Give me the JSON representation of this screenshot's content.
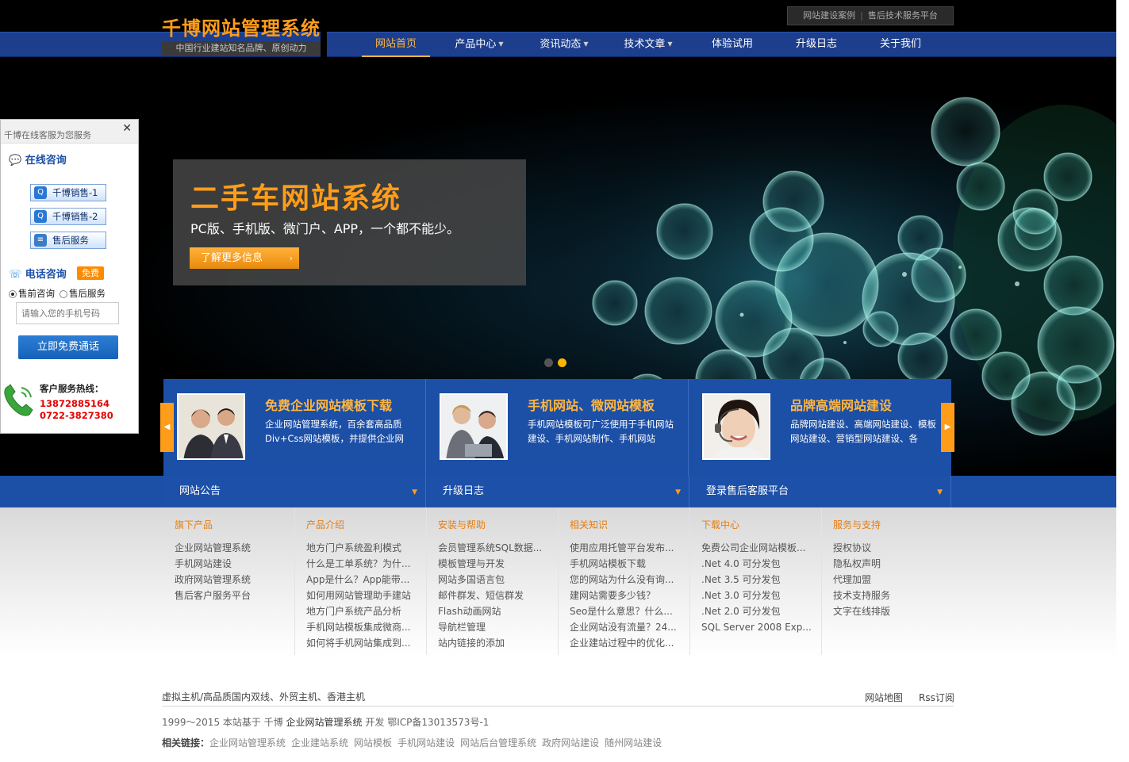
{
  "header": {
    "logo_title": "千博网站管理系统",
    "logo_slogan": "中国行业建站知名品牌、原创动力",
    "top_links": [
      "网站建设案例",
      "售后技术服务平台"
    ],
    "top_links_sep": "|"
  },
  "nav": {
    "items": [
      {
        "label": "网站首页",
        "active": true
      },
      {
        "label": "产品中心",
        "dropdown": true
      },
      {
        "label": "资讯动态",
        "dropdown": true
      },
      {
        "label": "技术文章",
        "dropdown": true
      },
      {
        "label": "体验试用"
      },
      {
        "label": "升级日志"
      },
      {
        "label": "关于我们"
      }
    ],
    "caret": "▼"
  },
  "banner": {
    "title": "二手车网站系统",
    "subtitle": "PC版、手机版、微门户、APP，一个都不能少。",
    "button": "了解更多信息",
    "button_arrow": "›",
    "active_slide": 2,
    "slide_count": 2
  },
  "features": [
    {
      "title": "免费企业网站模板下载",
      "desc": "企业网站管理系统，百余套高品质Div+Css网站模板，并提供企业网"
    },
    {
      "title": "手机网站、微网站模板",
      "desc": "手机网站模板可广泛使用于手机网站建设、手机网站制作、手机网站"
    },
    {
      "title": "品牌高端网站建设",
      "desc": "品牌网站建设、高端网站建设、模板网站建设、营销型网站建设、各"
    }
  ],
  "feature_arrows": {
    "left": "◀",
    "right": "▶"
  },
  "info_tabs": [
    "网站公告",
    "升级日志",
    "登录售后客服平台"
  ],
  "info_tab_marker": "▼",
  "link_columns": [
    {
      "head": "旗下产品",
      "items": [
        "企业网站管理系统",
        "手机网站建设",
        "政府网站管理系统",
        "售后客户服务平台"
      ]
    },
    {
      "head": "产品介绍",
      "items": [
        "地方门户系统盈利模式",
        "什么是工单系统？为什...",
        "App是什么？App能带...",
        "如何用网站管理助手建站",
        "地方门户系统产品分析",
        "手机网站模板集成微商...",
        "如何将手机网站集成到..."
      ]
    },
    {
      "head": "安装与帮助",
      "items": [
        "会员管理系统SQL数据...",
        "模板管理与开发",
        "网站多国语言包",
        "邮件群发、短信群发",
        "Flash动画网站",
        "导航栏管理",
        "站内链接的添加"
      ]
    },
    {
      "head": "相关知识",
      "items": [
        "使用应用托管平台发布...",
        "手机网站模板下载",
        "您的网站为什么没有询...",
        "建网站需要多少钱？",
        "Seo是什么意思？什么...",
        "企业网站没有流量？24...",
        "企业建站过程中的优化..."
      ]
    },
    {
      "head": "下载中心",
      "items": [
        "免费公司企业网站模板...",
        ".Net 4.0 可分发包",
        ".Net 3.5 可分发包",
        ".Net 3.0 可分发包",
        ".Net 2.0 可分发包",
        "SQL Server 2008 Exp..."
      ]
    },
    {
      "head": "服务与支持",
      "items": [
        "授权协议",
        "隐私权声明",
        "代理加盟",
        "技术支持服务",
        "文字在线排版"
      ]
    }
  ],
  "footer": {
    "hosting": "虚拟主机/高品质国内双线、外贸主机、香港主机",
    "sitemap": "网站地图",
    "rss": "Rss订阅",
    "copyright_pre": "1999～2015 本站基于 千博",
    "copyright_link": "企业网站管理系统",
    "copyright_post": "开发 鄂ICP备13013573号-1",
    "related_label": "相关链接：",
    "related_links": [
      "企业网站管理系统",
      "企业建站系统",
      "网站模板",
      "手机网站建设",
      "网站后台管理系统",
      "政府网站建设",
      "随州网站建设"
    ]
  },
  "chat_panel": {
    "header": "千博在线客服为您服务",
    "close": "✕",
    "online_title": "在线咨询",
    "qq_buttons": [
      "千博销售-1",
      "千博销售-2",
      "售后服务"
    ],
    "phone_title": "电话咨询",
    "free_badge": "免费",
    "radio_options": [
      "售前咨询",
      "售后服务"
    ],
    "phone_placeholder": "请输入您的手机号码",
    "call_button": "立即免费通话",
    "hotline_label": "客户服务热线：",
    "hotline_numbers": [
      "13872885164",
      "0722-3827380"
    ]
  },
  "colors": {
    "nav_blue": "#1c3e8c",
    "strip_blue": "#1c4fa6",
    "accent_orange": "#ff9d1a",
    "hotline_red": "#e60000"
  }
}
